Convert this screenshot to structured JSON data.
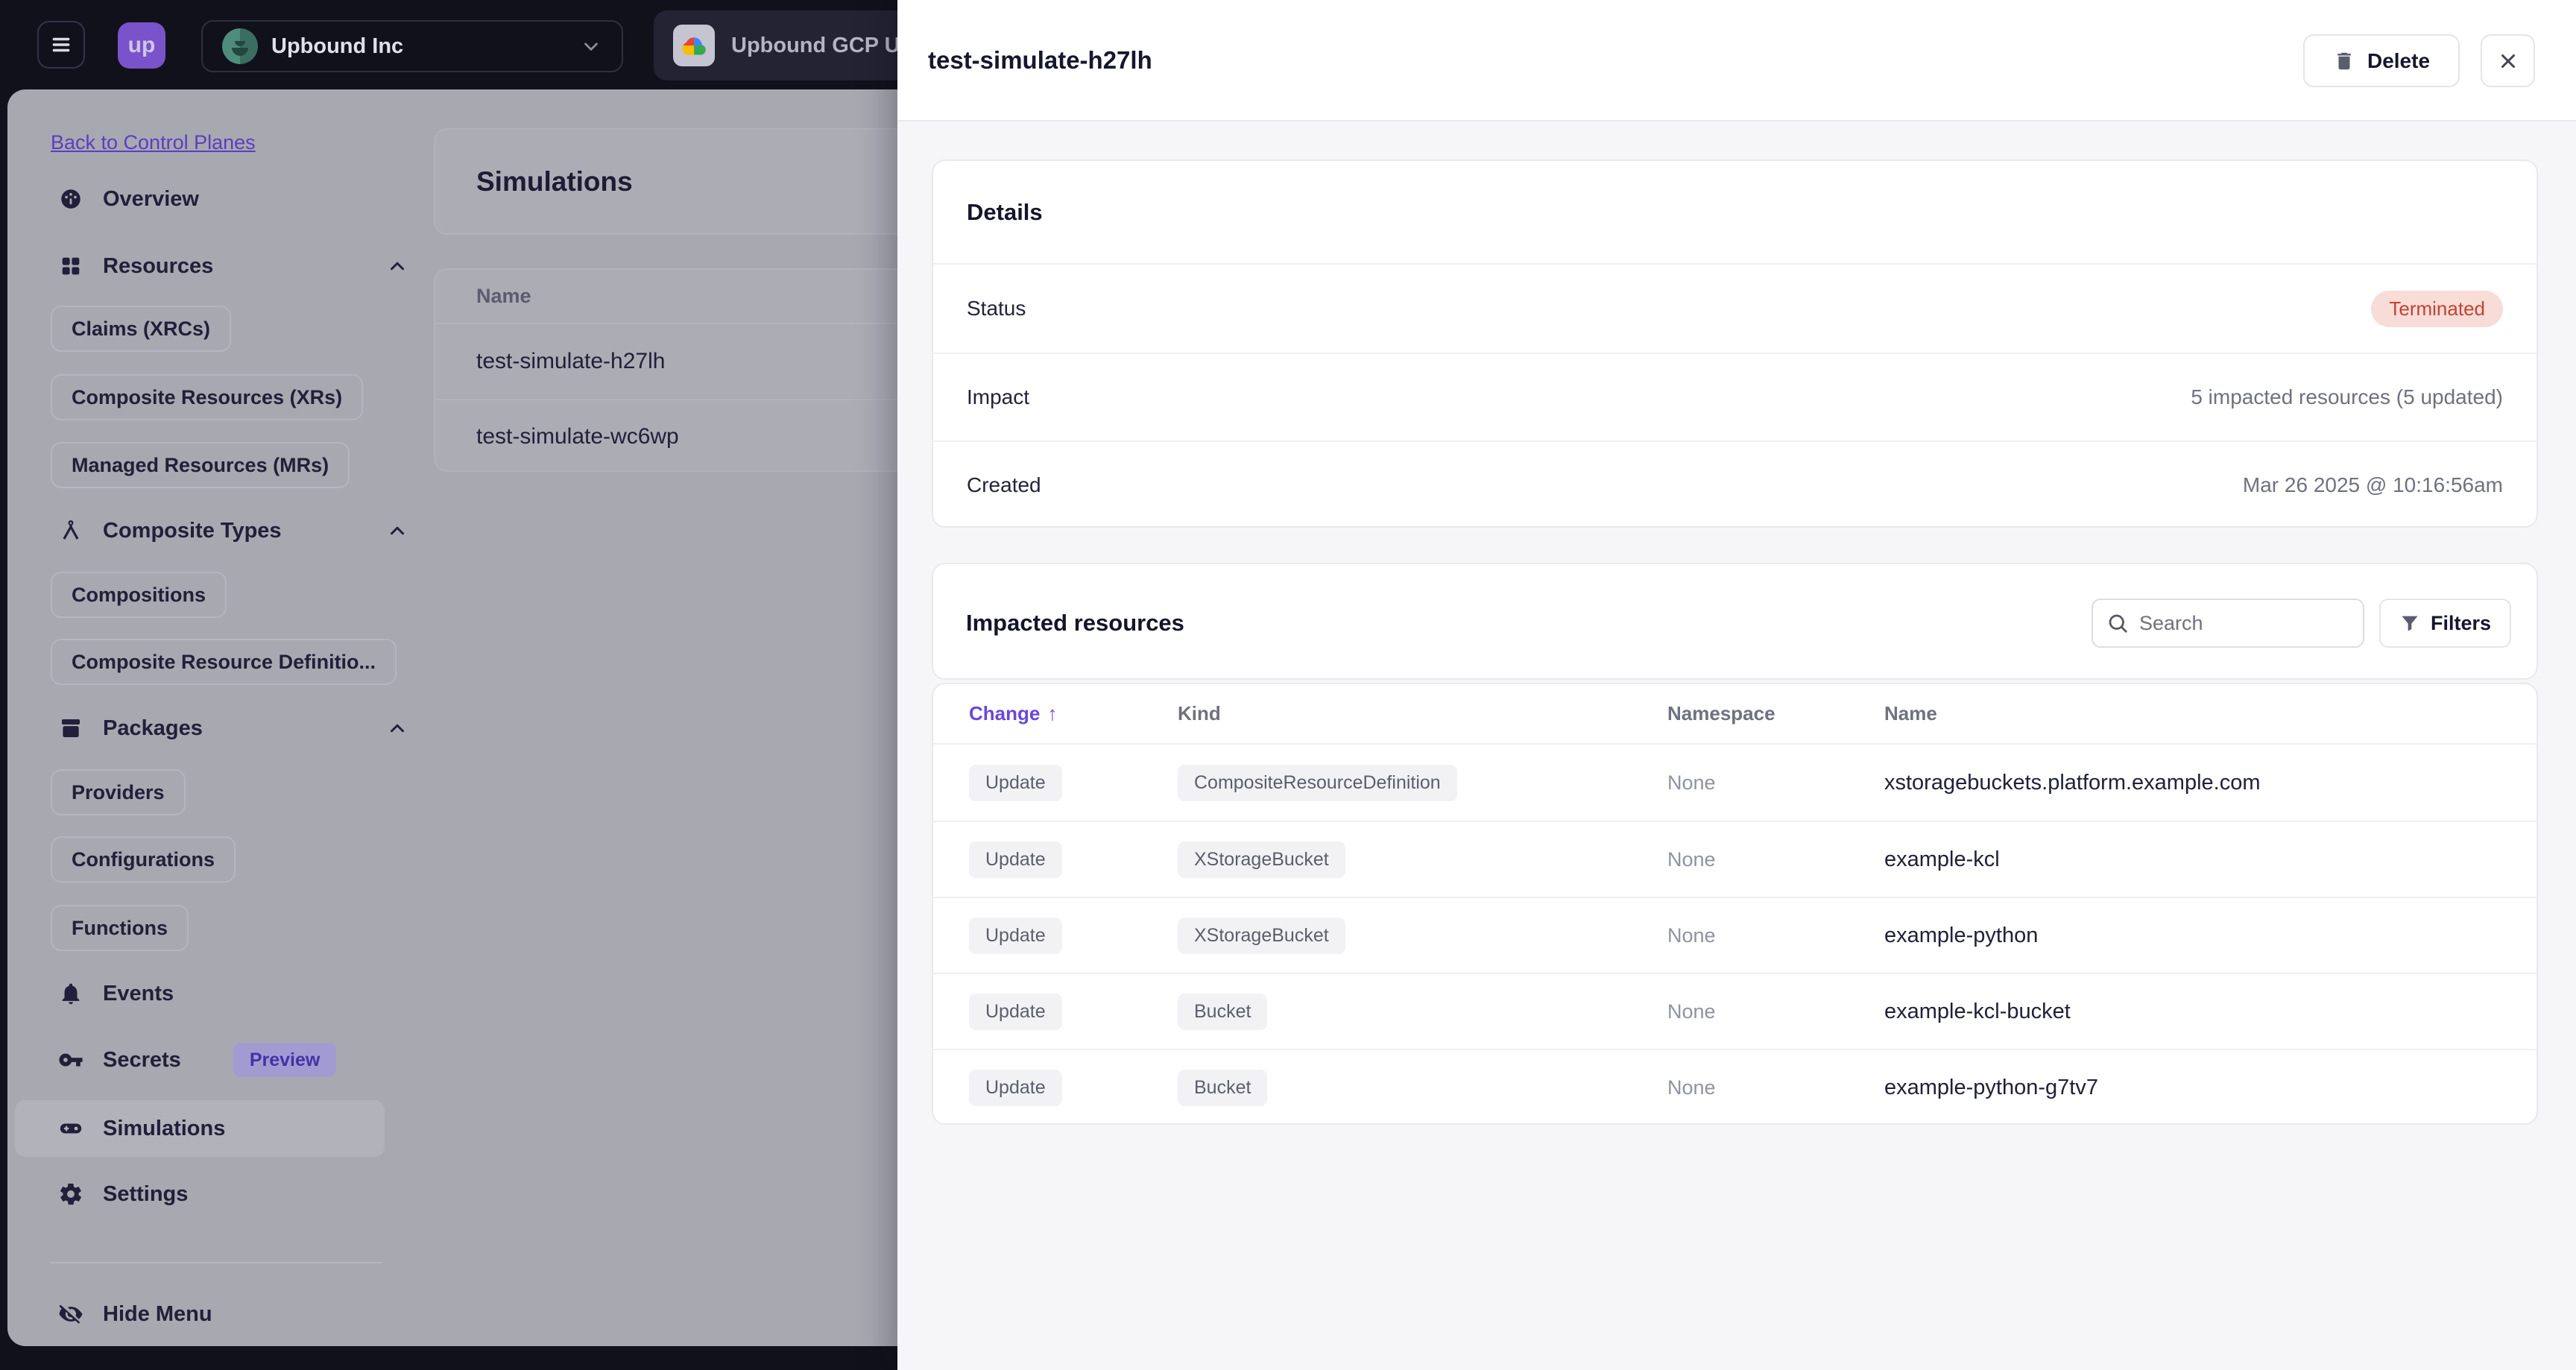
{
  "topbar": {
    "logo": "up",
    "org": "Upbound Inc",
    "workspace_tab": "Upbound GCP U"
  },
  "sidebar": {
    "back_link": "Back to Control Planes",
    "overview": "Overview",
    "resources": "Resources",
    "claims_chip": "Claims (XRCs)",
    "xr_chip": "Composite Resources (XRs)",
    "mr_chip": "Managed Resources (MRs)",
    "composite_types": "Composite Types",
    "compositions_chip": "Compositions",
    "xrd_chip": "Composite Resource Definitio...",
    "packages": "Packages",
    "providers_chip": "Providers",
    "configurations_chip": "Configurations",
    "functions_chip": "Functions",
    "events": "Events",
    "secrets": "Secrets",
    "secrets_badge": "Preview",
    "simulations": "Simulations",
    "settings": "Settings",
    "hide_menu": "Hide Menu"
  },
  "main": {
    "title": "Simulations",
    "list": {
      "header": "Name",
      "rows": [
        "test-simulate-h27lh",
        "test-simulate-wc6wp"
      ]
    }
  },
  "drawer": {
    "title": "test-simulate-h27lh",
    "delete_label": "Delete",
    "details": {
      "title": "Details",
      "status_label": "Status",
      "status_value": "Terminated",
      "impact_label": "Impact",
      "impact_value": "5 impacted resources (5 updated)",
      "created_label": "Created",
      "created_value": "Mar 26 2025 @ 10:16:56am"
    },
    "impacted": {
      "title": "Impacted resources",
      "search_placeholder": "Search",
      "filters_label": "Filters",
      "sort_arrow": "↑",
      "columns": {
        "change": "Change",
        "kind": "Kind",
        "namespace": "Namespace",
        "name": "Name"
      },
      "rows": [
        {
          "change": "Update",
          "kind": "CompositeResourceDefinition",
          "namespace": "None",
          "name": "xstoragebuckets.platform.example.com"
        },
        {
          "change": "Update",
          "kind": "XStorageBucket",
          "namespace": "None",
          "name": "example-kcl"
        },
        {
          "change": "Update",
          "kind": "XStorageBucket",
          "namespace": "None",
          "name": "example-python"
        },
        {
          "change": "Update",
          "kind": "Bucket",
          "namespace": "None",
          "name": "example-kcl-bucket"
        },
        {
          "change": "Update",
          "kind": "Bucket",
          "namespace": "None",
          "name": "example-python-g7tv7"
        }
      ]
    }
  },
  "colors": {
    "topbar_bg": "#11111c",
    "brand_purple": "#7a52c9",
    "accent_purple": "#6b46d8",
    "link_purple": "#5b3fbe",
    "terminated_bg": "#f8dcd8",
    "terminated_text": "#c04531",
    "preview_badge_bg": "#a29bd1",
    "preview_badge_text": "#4531a8",
    "dimmed_surface": "#a8a8b1",
    "drawer_bg": "#f6f6f8",
    "card_border": "#e9e9ec",
    "muted_text": "#6f7180",
    "dark_text": "#16162e"
  }
}
